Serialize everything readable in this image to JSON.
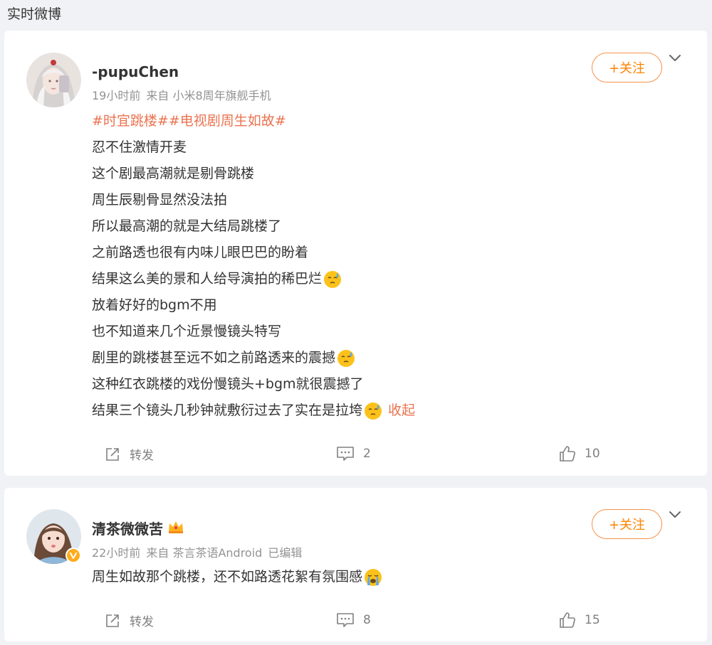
{
  "header": {
    "title": "实时微博"
  },
  "posts": [
    {
      "author": "-pupuChen",
      "time": "19小时前",
      "source": "来自 小米8周年旗舰手机",
      "edited": "",
      "follow_label": "+关注",
      "hashtags": "#时宜跳楼##电视剧周生如故#",
      "lines": [
        "忍不住激情开麦",
        "这个剧最高潮就是剔骨跳楼",
        "周生辰剔骨显然没法拍",
        "所以最高潮的就是大结局跳楼了",
        "之前路透也很有内味儿眼巴巴的盼着",
        "结果这么美的景和人给导演拍的稀巴烂",
        "放着好好的bgm不用",
        "也不知道来几个近景慢镜头特写",
        "剧里的跳楼甚至远不如之前路透来的震撼",
        "这种红衣跳楼的戏份慢镜头+bgm就很震撼了",
        "结果三个镜头几秒钟就敷衍过去了实在是拉垮"
      ],
      "collapse_label": "收起",
      "repost_label": "转发",
      "comment_count": "2",
      "like_count": "10"
    },
    {
      "author": "清茶微微苦",
      "time": "22小时前",
      "source": "来自 茶言茶语Android",
      "edited": "已编辑",
      "follow_label": "+关注",
      "lines": [
        "周生如故那个跳楼，还不如路透花絮有氛围感"
      ],
      "repost_label": "转发",
      "comment_count": "8",
      "like_count": "15"
    }
  ],
  "colors": {
    "accent": "#ff8200",
    "link": "#eb7350",
    "muted": "#939393",
    "background": "#f1f2f5"
  },
  "icons": [
    "chevron-down-icon",
    "repost-icon",
    "comment-icon",
    "like-icon",
    "sweat-emoji-icon",
    "crying-emoji-icon",
    "crown-badge-icon",
    "verified-badge-icon"
  ]
}
